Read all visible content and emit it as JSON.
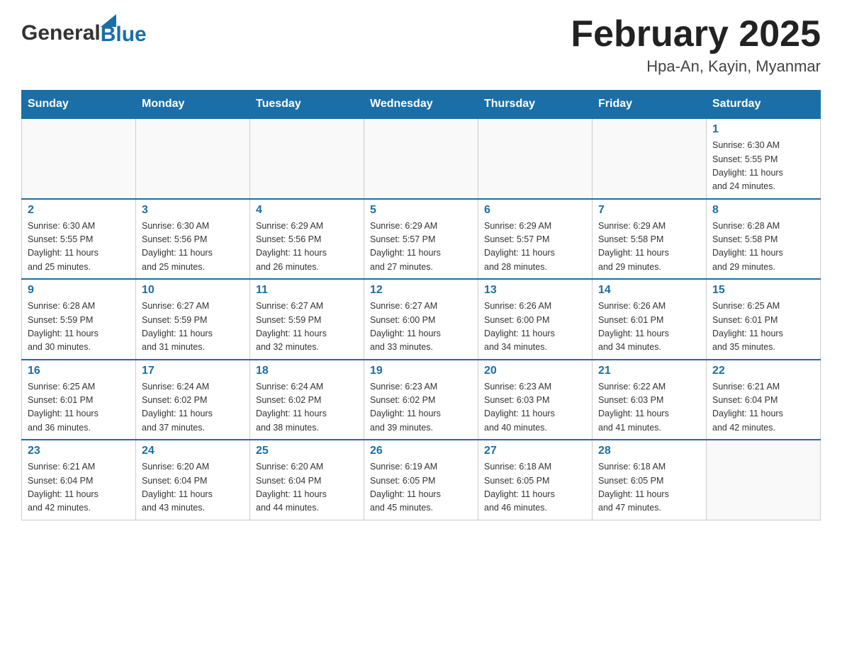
{
  "header": {
    "logo_general": "General",
    "logo_blue": "Blue",
    "month_title": "February 2025",
    "location": "Hpa-An, Kayin, Myanmar"
  },
  "weekdays": [
    "Sunday",
    "Monday",
    "Tuesday",
    "Wednesday",
    "Thursday",
    "Friday",
    "Saturday"
  ],
  "weeks": [
    [
      {
        "day": "",
        "info": ""
      },
      {
        "day": "",
        "info": ""
      },
      {
        "day": "",
        "info": ""
      },
      {
        "day": "",
        "info": ""
      },
      {
        "day": "",
        "info": ""
      },
      {
        "day": "",
        "info": ""
      },
      {
        "day": "1",
        "info": "Sunrise: 6:30 AM\nSunset: 5:55 PM\nDaylight: 11 hours\nand 24 minutes."
      }
    ],
    [
      {
        "day": "2",
        "info": "Sunrise: 6:30 AM\nSunset: 5:55 PM\nDaylight: 11 hours\nand 25 minutes."
      },
      {
        "day": "3",
        "info": "Sunrise: 6:30 AM\nSunset: 5:56 PM\nDaylight: 11 hours\nand 25 minutes."
      },
      {
        "day": "4",
        "info": "Sunrise: 6:29 AM\nSunset: 5:56 PM\nDaylight: 11 hours\nand 26 minutes."
      },
      {
        "day": "5",
        "info": "Sunrise: 6:29 AM\nSunset: 5:57 PM\nDaylight: 11 hours\nand 27 minutes."
      },
      {
        "day": "6",
        "info": "Sunrise: 6:29 AM\nSunset: 5:57 PM\nDaylight: 11 hours\nand 28 minutes."
      },
      {
        "day": "7",
        "info": "Sunrise: 6:29 AM\nSunset: 5:58 PM\nDaylight: 11 hours\nand 29 minutes."
      },
      {
        "day": "8",
        "info": "Sunrise: 6:28 AM\nSunset: 5:58 PM\nDaylight: 11 hours\nand 29 minutes."
      }
    ],
    [
      {
        "day": "9",
        "info": "Sunrise: 6:28 AM\nSunset: 5:59 PM\nDaylight: 11 hours\nand 30 minutes."
      },
      {
        "day": "10",
        "info": "Sunrise: 6:27 AM\nSunset: 5:59 PM\nDaylight: 11 hours\nand 31 minutes."
      },
      {
        "day": "11",
        "info": "Sunrise: 6:27 AM\nSunset: 5:59 PM\nDaylight: 11 hours\nand 32 minutes."
      },
      {
        "day": "12",
        "info": "Sunrise: 6:27 AM\nSunset: 6:00 PM\nDaylight: 11 hours\nand 33 minutes."
      },
      {
        "day": "13",
        "info": "Sunrise: 6:26 AM\nSunset: 6:00 PM\nDaylight: 11 hours\nand 34 minutes."
      },
      {
        "day": "14",
        "info": "Sunrise: 6:26 AM\nSunset: 6:01 PM\nDaylight: 11 hours\nand 34 minutes."
      },
      {
        "day": "15",
        "info": "Sunrise: 6:25 AM\nSunset: 6:01 PM\nDaylight: 11 hours\nand 35 minutes."
      }
    ],
    [
      {
        "day": "16",
        "info": "Sunrise: 6:25 AM\nSunset: 6:01 PM\nDaylight: 11 hours\nand 36 minutes."
      },
      {
        "day": "17",
        "info": "Sunrise: 6:24 AM\nSunset: 6:02 PM\nDaylight: 11 hours\nand 37 minutes."
      },
      {
        "day": "18",
        "info": "Sunrise: 6:24 AM\nSunset: 6:02 PM\nDaylight: 11 hours\nand 38 minutes."
      },
      {
        "day": "19",
        "info": "Sunrise: 6:23 AM\nSunset: 6:02 PM\nDaylight: 11 hours\nand 39 minutes."
      },
      {
        "day": "20",
        "info": "Sunrise: 6:23 AM\nSunset: 6:03 PM\nDaylight: 11 hours\nand 40 minutes."
      },
      {
        "day": "21",
        "info": "Sunrise: 6:22 AM\nSunset: 6:03 PM\nDaylight: 11 hours\nand 41 minutes."
      },
      {
        "day": "22",
        "info": "Sunrise: 6:21 AM\nSunset: 6:04 PM\nDaylight: 11 hours\nand 42 minutes."
      }
    ],
    [
      {
        "day": "23",
        "info": "Sunrise: 6:21 AM\nSunset: 6:04 PM\nDaylight: 11 hours\nand 42 minutes."
      },
      {
        "day": "24",
        "info": "Sunrise: 6:20 AM\nSunset: 6:04 PM\nDaylight: 11 hours\nand 43 minutes."
      },
      {
        "day": "25",
        "info": "Sunrise: 6:20 AM\nSunset: 6:04 PM\nDaylight: 11 hours\nand 44 minutes."
      },
      {
        "day": "26",
        "info": "Sunrise: 6:19 AM\nSunset: 6:05 PM\nDaylight: 11 hours\nand 45 minutes."
      },
      {
        "day": "27",
        "info": "Sunrise: 6:18 AM\nSunset: 6:05 PM\nDaylight: 11 hours\nand 46 minutes."
      },
      {
        "day": "28",
        "info": "Sunrise: 6:18 AM\nSunset: 6:05 PM\nDaylight: 11 hours\nand 47 minutes."
      },
      {
        "day": "",
        "info": ""
      }
    ]
  ]
}
